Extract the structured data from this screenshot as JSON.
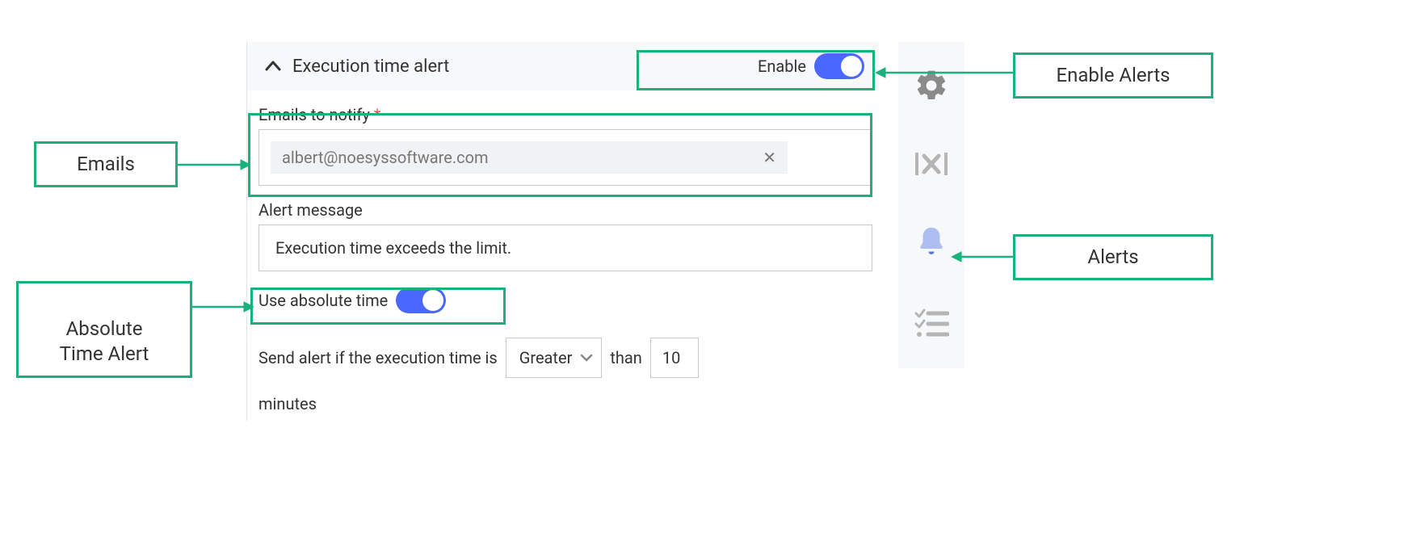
{
  "header": {
    "title": "Execution time alert",
    "enable_label": "Enable"
  },
  "emails": {
    "label": "Emails to notify",
    "chip": "albert@noesyssoftware.com"
  },
  "alert_msg": {
    "label": "Alert message",
    "value": "Execution time exceeds the limit."
  },
  "abs_time": {
    "label": "Use absolute time"
  },
  "condition": {
    "prefix": "Send alert if the execution time is",
    "operator": "Greater",
    "than": "than",
    "value": "10",
    "unit": "minutes"
  },
  "callouts": {
    "enable": "Enable Alerts",
    "emails": "Emails",
    "abs": "Absolute\nTime Alert",
    "alerts": "Alerts"
  }
}
